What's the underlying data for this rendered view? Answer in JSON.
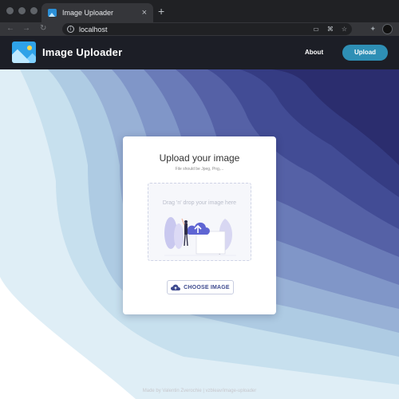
{
  "browser": {
    "tab_title": "Image Uploader",
    "tab_close": "×",
    "new_tab": "+",
    "url": "localhost",
    "nav": {
      "back": "←",
      "forward": "→",
      "reload": "↻"
    }
  },
  "header": {
    "app_title": "Image Uploader",
    "about_label": "About",
    "upload_label": "Upload"
  },
  "card": {
    "title": "Upload your image",
    "subtitle": "File should be Jpeg, Png,...",
    "drop_hint": "Drag 'n' drop your image here",
    "choose_label": "CHOOSE IMAGE"
  },
  "footer": {
    "text": "Made by Valentin Zverochie | vzbleav/image-uploader"
  },
  "colors": {
    "appbar": "#1c1e26",
    "accent": "#2e8fb5",
    "wave_darkest": "#2b2d6e"
  },
  "icons": {
    "logo": "image-logo-icon",
    "choose": "cloud-upload-icon"
  }
}
